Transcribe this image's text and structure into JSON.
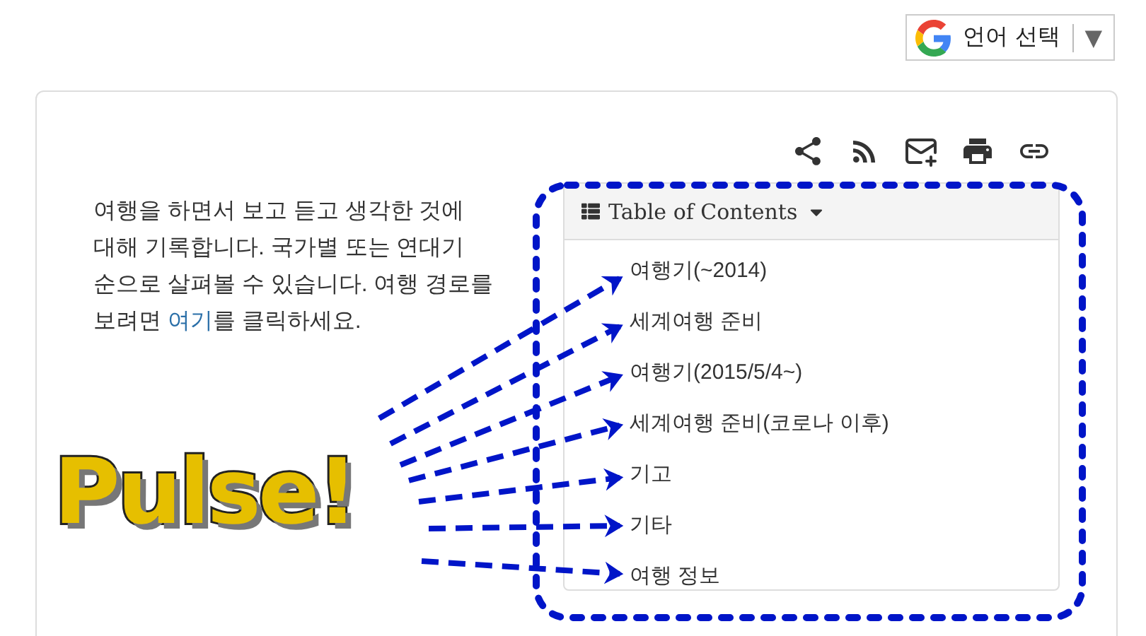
{
  "translate_widget": {
    "label": "언어 선택",
    "caret": "▼"
  },
  "intro": {
    "before": "여행을 하면서 보고 듣고 생각한 것에 대해 기록합니다. 국가별 또는 연대기 순으로 살펴볼 수 있습니다. 여행 경로를 보려면 ",
    "link": "여기",
    "after": "를 클릭하세요."
  },
  "toc": {
    "title": "Table of Contents",
    "expanded": true,
    "items": [
      "여행기(~2014)",
      "세계여행 준비",
      "여행기(2015/5/4~)",
      "세계여행 준비(코로나 이후)",
      "기고",
      "기타",
      "여행 정보"
    ]
  },
  "annotation": {
    "text": "Pulse!"
  }
}
